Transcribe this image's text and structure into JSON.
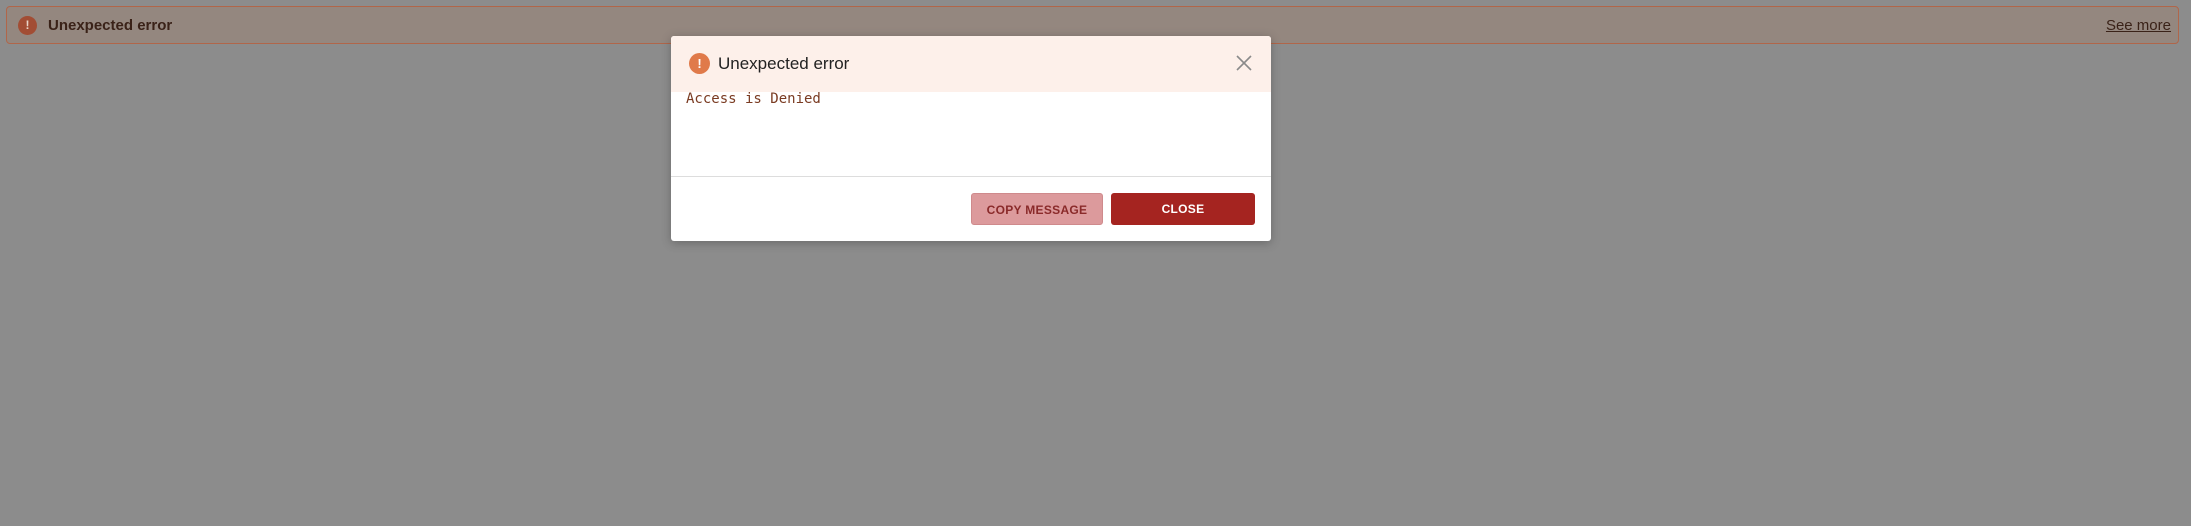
{
  "banner": {
    "icon": "exclamation-icon",
    "title": "Unexpected error",
    "link_label": "See more"
  },
  "dialog": {
    "icon": "exclamation-icon",
    "title": "Unexpected error",
    "close_icon": "close-icon",
    "message": "Access is Denied",
    "copy_label": "COPY MESSAGE",
    "close_label": "CLOSE"
  },
  "colors": {
    "backdrop": "#8c8c8c",
    "banner_border": "#b0664a",
    "header_bg": "#fdf0ea",
    "warning_icon": "#e07a4a",
    "primary_button": "#a52420",
    "secondary_button": "#dc9a9c",
    "message_text": "#7a3b22"
  }
}
